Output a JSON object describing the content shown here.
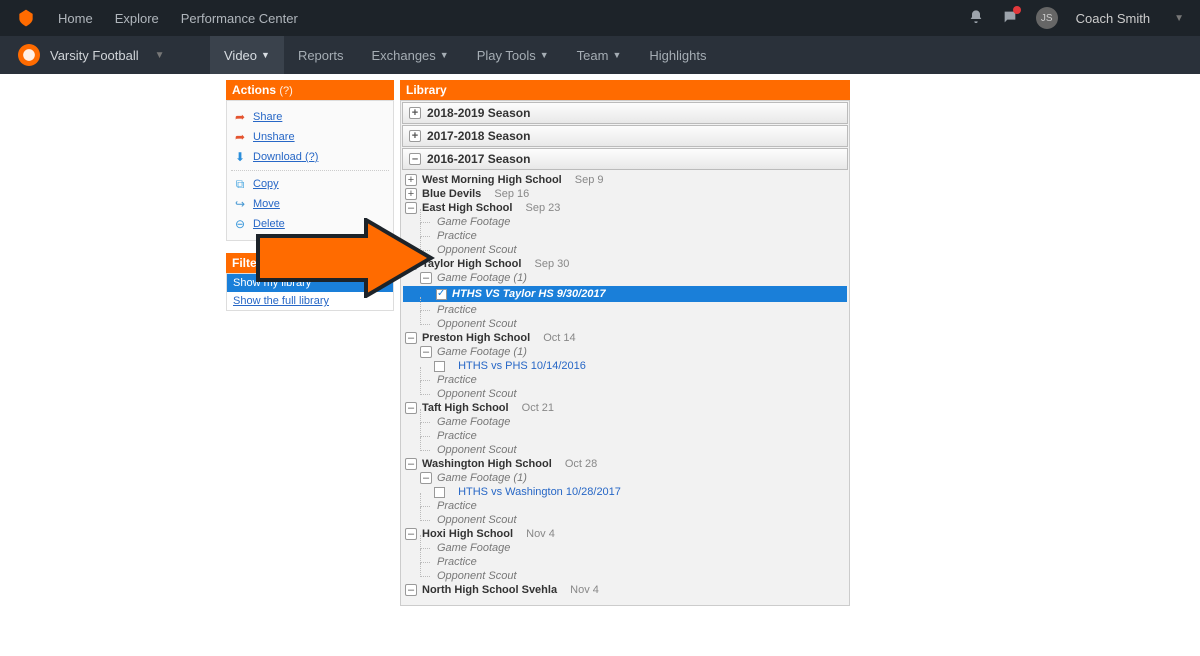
{
  "topnav": {
    "home": "Home",
    "explore": "Explore",
    "perf": "Performance Center",
    "user_initials": "JS",
    "user": "Coach Smith"
  },
  "subnav": {
    "team": "Varsity Football",
    "tabs": [
      "Video",
      "Reports",
      "Exchanges",
      "Play Tools",
      "Team",
      "Highlights"
    ]
  },
  "actions": {
    "title": "Actions",
    "help": "(?)",
    "share": "Share",
    "unshare": "Unshare",
    "download": "Download",
    "download_help": "(?)",
    "copy": "Copy",
    "move": "Move",
    "delete": "Delete"
  },
  "filter": {
    "title": "Filter Your View",
    "help": "(?)",
    "opt1": "Show my library",
    "opt2": "Show the full library"
  },
  "library": {
    "title": "Library",
    "seasons": [
      {
        "label": "2018-2019 Season",
        "expanded": false
      },
      {
        "label": "2017-2018 Season",
        "expanded": false
      },
      {
        "label": "2016-2017 Season",
        "expanded": true
      }
    ],
    "wm": {
      "name": "West Morning High School",
      "date": "Sep 9"
    },
    "bd": {
      "name": "Blue Devils",
      "date": "Sep 16"
    },
    "eh": {
      "name": "East High School",
      "date": "Sep 23"
    },
    "gf": "Game Footage",
    "pr": "Practice",
    "os": "Opponent Scout",
    "ty": {
      "name": "Taylor High School",
      "date": "Sep 30",
      "gf": "Game Footage (1)",
      "video": "HTHS VS Taylor HS 9/30/2017"
    },
    "ph": {
      "name": "Preston High School",
      "date": "Oct 14",
      "gf": "Game Footage (1)",
      "video": "HTHS vs PHS 10/14/2016"
    },
    "tf": {
      "name": "Taft High School",
      "date": "Oct 21"
    },
    "wa": {
      "name": "Washington High School",
      "date": "Oct 28",
      "gf": "Game Footage (1)",
      "video": "HTHS vs Washington 10/28/2017"
    },
    "hx": {
      "name": "Hoxi High School",
      "date": "Nov 4"
    },
    "nh": {
      "name": "North High School Svehla",
      "date": "Nov 4"
    }
  }
}
